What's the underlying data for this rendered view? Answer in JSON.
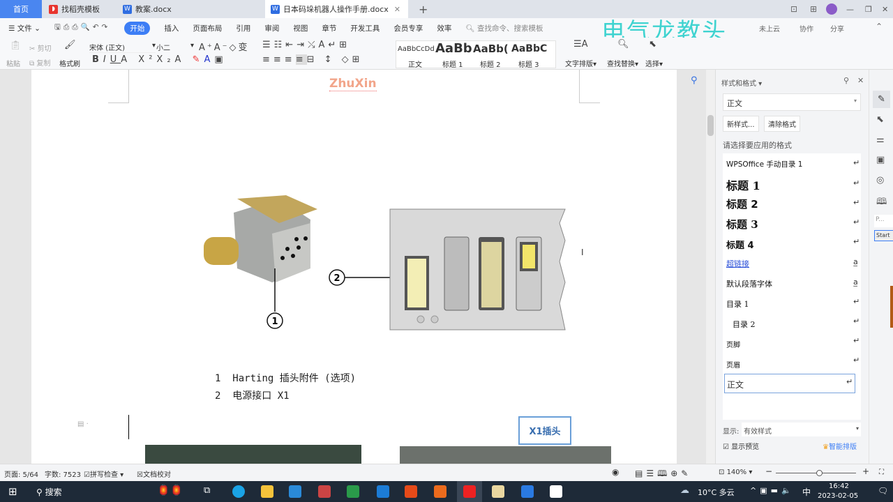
{
  "tabs": [
    {
      "label": "首页"
    },
    {
      "label": "找稻壳模板"
    },
    {
      "label": "教案.docx"
    },
    {
      "label": "日本码垛机器人操作手册.docx"
    }
  ],
  "menu": {
    "file": "文件",
    "items": [
      "开始",
      "插入",
      "页面布局",
      "引用",
      "审阅",
      "视图",
      "章节",
      "开发工具",
      "会员专享",
      "效率"
    ],
    "search_placeholder": "查找命令、搜索模板",
    "cloud": "未上云",
    "collab": "协作",
    "share": "分享"
  },
  "watermark": "电气龙教头",
  "ribbon": {
    "paste": "粘贴",
    "cut": "剪切",
    "copy": "复制",
    "format_painter": "格式刷",
    "font": "宋体 (正文)",
    "size": "小二",
    "styles": [
      {
        "preview": "AaBbCcDd",
        "label": "正文"
      },
      {
        "preview": "AaBb",
        "label": "标题 1"
      },
      {
        "preview": "AaBb(",
        "label": "标题 2"
      },
      {
        "preview": "AaBbC(",
        "label": "标题 3"
      }
    ],
    "text_layout": "文字排版",
    "find_replace": "查找替换",
    "select": "选择"
  },
  "document": {
    "header_text": "ZhuXin",
    "callout1": "1",
    "callout2": "2",
    "captions": [
      {
        "num": "1",
        "text": "Harting 插头附件 (选项)"
      },
      {
        "num": "2",
        "text": "电源接口 X1"
      }
    ],
    "label_box": "X1插头"
  },
  "panel": {
    "title": "样式和格式",
    "current_style": "正文",
    "new_style": "新样式...",
    "clear_format": "清除格式",
    "prompt": "请选择要应用的格式",
    "styles": [
      "WPSOffice 手动目录 1",
      "标题 1",
      "标题 2",
      "标题 3",
      "标题 4",
      "超链接",
      "默认段落字体",
      "目录 1",
      "目录 2",
      "页脚",
      "页眉",
      "正文"
    ],
    "show_label": "显示:",
    "show_value": "有效样式",
    "preview_label": "显示预览",
    "smart_layout": "智能排版"
  },
  "side": {
    "popup_text": "P...",
    "start": "Start"
  },
  "status": {
    "page": "页面: 5/64",
    "words": "字数: 7523",
    "spell": "拼写检查",
    "proof": "文档校对",
    "zoom": "140%"
  },
  "taskbar": {
    "search": "搜索",
    "weather": "10°C 多云",
    "ime": "中",
    "time": "16:42",
    "date": "2023-02-05"
  },
  "colors": {
    "accent": "#3d7ef5",
    "taskbar": "#1e2a38"
  }
}
